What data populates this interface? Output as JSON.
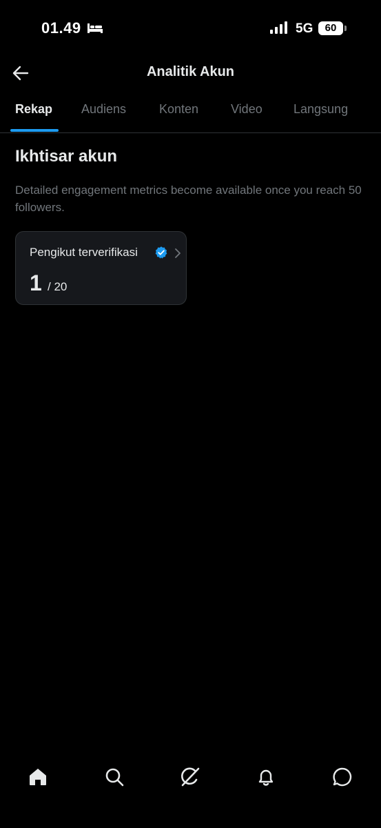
{
  "status_bar": {
    "time": "01.49",
    "network": "5G",
    "battery_level": "60"
  },
  "header": {
    "title": "Analitik Akun"
  },
  "tabs": [
    {
      "label": "Rekap",
      "active": true
    },
    {
      "label": "Audiens",
      "active": false
    },
    {
      "label": "Konten",
      "active": false
    },
    {
      "label": "Video",
      "active": false
    },
    {
      "label": "Langsung",
      "active": false
    }
  ],
  "overview": {
    "title": "Ikhtisar akun",
    "description": "Detailed engagement metrics become available once you reach 50 followers.",
    "card": {
      "label": "Pengikut terverifikasi",
      "value": "1",
      "target": "/ 20"
    }
  },
  "bottom_nav": {
    "items": [
      "home-icon",
      "search-icon",
      "grok-icon",
      "notifications-icon",
      "messages-icon"
    ]
  },
  "colors": {
    "background": "#000000",
    "accent": "#1d9bf0",
    "text_primary": "#e7e9ea",
    "text_secondary": "#71767b",
    "card_background": "#16181c",
    "border": "#2f3336"
  }
}
